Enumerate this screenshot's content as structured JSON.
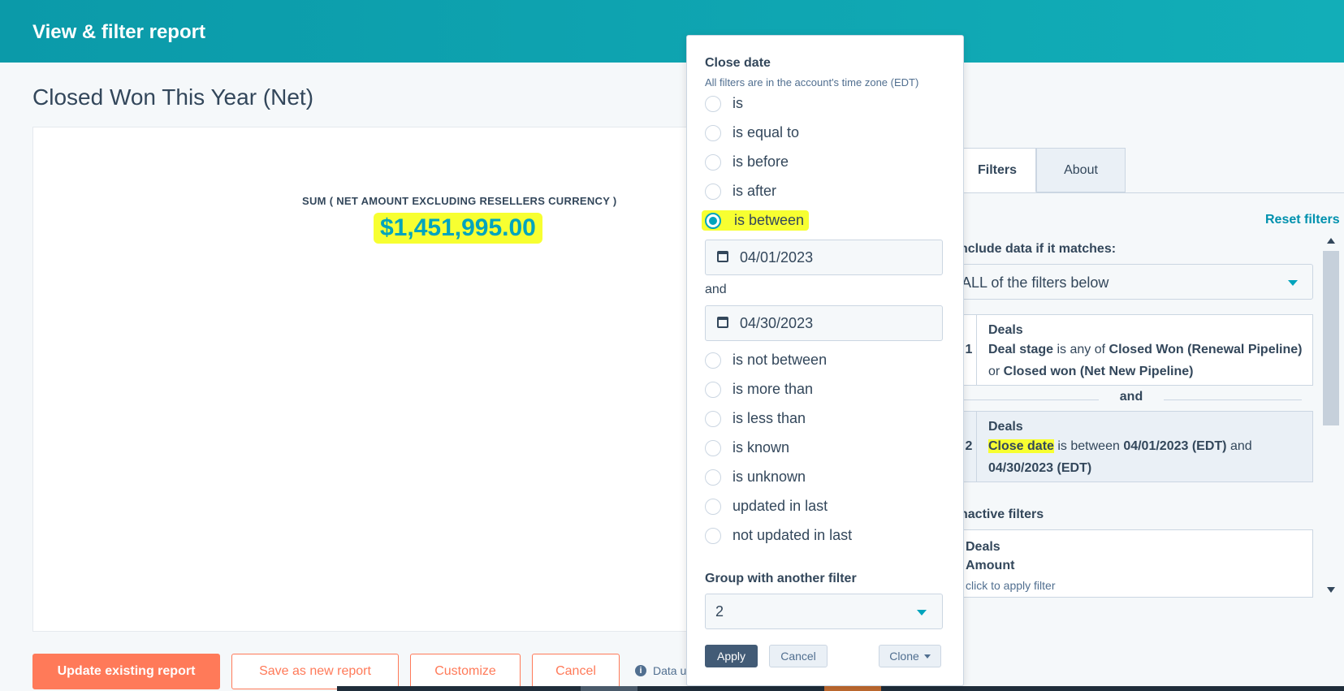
{
  "header": {
    "title": "View & filter report"
  },
  "report": {
    "title": "Closed Won This Year (Net)",
    "metric_label": "SUM ( NET AMOUNT EXCLUDING RESELLERS CURRENCY )",
    "metric_value": "$1,451,995.00"
  },
  "actions": {
    "update": "Update existing report",
    "save_new": "Save as new report",
    "customize": "Customize",
    "cancel": "Cancel",
    "data_note": "Data u"
  },
  "popover": {
    "title": "Close date",
    "subtitle": "All filters are in the account's time zone (EDT)",
    "options_top": [
      {
        "label": "is",
        "checked": false
      },
      {
        "label": "is equal to",
        "checked": false
      },
      {
        "label": "is before",
        "checked": false
      },
      {
        "label": "is after",
        "checked": false
      },
      {
        "label": "is between",
        "checked": true
      }
    ],
    "start_date": "04/01/2023",
    "and_label": "and",
    "end_date": "04/30/2023",
    "options_bottom": [
      {
        "label": "is not between"
      },
      {
        "label": "is more than"
      },
      {
        "label": "is less than"
      },
      {
        "label": "is known"
      },
      {
        "label": "is unknown"
      },
      {
        "label": "updated in last"
      },
      {
        "label": "not updated in last"
      }
    ],
    "group_label": "Group with another filter",
    "group_value": "2",
    "apply": "Apply",
    "cancel": "Cancel",
    "clone": "Clone"
  },
  "filters": {
    "tabs": {
      "filters": "Filters",
      "about": "About"
    },
    "reset": "Reset filters",
    "match_label": "nclude data if it matches:",
    "match_value": "ALL of the filters below",
    "filter1": {
      "num": "1",
      "object": "Deals",
      "prop": "Deal stage",
      "op": " is any of ",
      "val1": "Closed Won (Renewal Pipeline)",
      "or": " or ",
      "val2": "Closed won (Net New Pipeline)"
    },
    "and": "and",
    "filter2": {
      "num": "2",
      "object": "Deals",
      "prop": "Close date",
      "op": " is between ",
      "val1": "04/01/2023 (EDT)",
      "and": " and ",
      "val2": "04/30/2023 (EDT)"
    },
    "inactive_title": "nactive filters",
    "inactive": {
      "object": "Deals",
      "prop": "Amount",
      "hint": "click to apply filter"
    }
  },
  "colors": {
    "accent": "#00a4bd",
    "orange": "#ff7a59",
    "highlight": "#f7ff31"
  }
}
